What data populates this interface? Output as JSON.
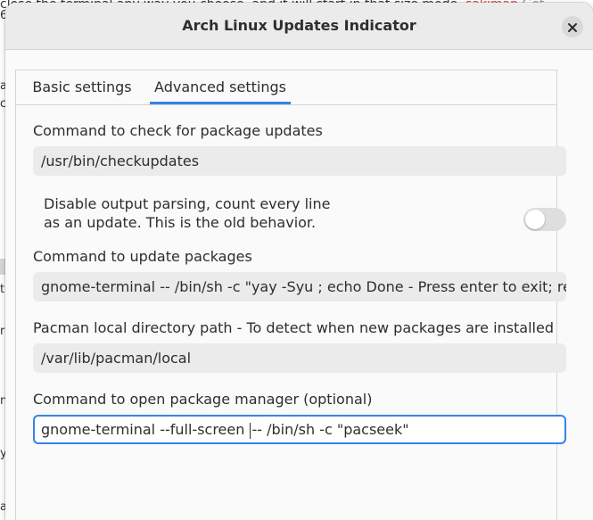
{
  "background": {
    "top_text": "close the terminal any way you choose, and it will start in that size mode.",
    "top_link": "sakimap",
    "top_dim": "Got",
    "fragments": [
      "6",
      "a",
      "c",
      "t",
      "rs",
      "nl",
      "y",
      "a"
    ]
  },
  "dialog": {
    "title": "Arch Linux Updates Indicator",
    "close_icon": "close-icon",
    "tabs": [
      {
        "label": "Basic settings",
        "active": false
      },
      {
        "label": "Advanced settings",
        "active": true
      }
    ],
    "fields": {
      "check_updates": {
        "label": "Command to check for package updates",
        "value": "/usr/bin/checkupdates"
      },
      "disable_parsing": {
        "line1": "Disable output parsing, count every line",
        "line2": "as an update. This is the old behavior.",
        "enabled": false
      },
      "update_packages": {
        "label": "Command to update packages",
        "value": "gnome-terminal -- /bin/sh -c \"yay -Syu ; echo Done - Press enter to exit; rea"
      },
      "pacman_dir": {
        "label": "Pacman local directory path - To detect when new packages are installed",
        "value": "/var/lib/pacman/local"
      },
      "package_manager": {
        "label": "Command to open package manager (optional)",
        "value_before_cursor": "gnome-terminal --full-screen ",
        "value_after_cursor": "-- /bin/sh -c \"pacseek\""
      }
    }
  },
  "colors": {
    "accent": "#3584e4",
    "link": "#d04848"
  }
}
